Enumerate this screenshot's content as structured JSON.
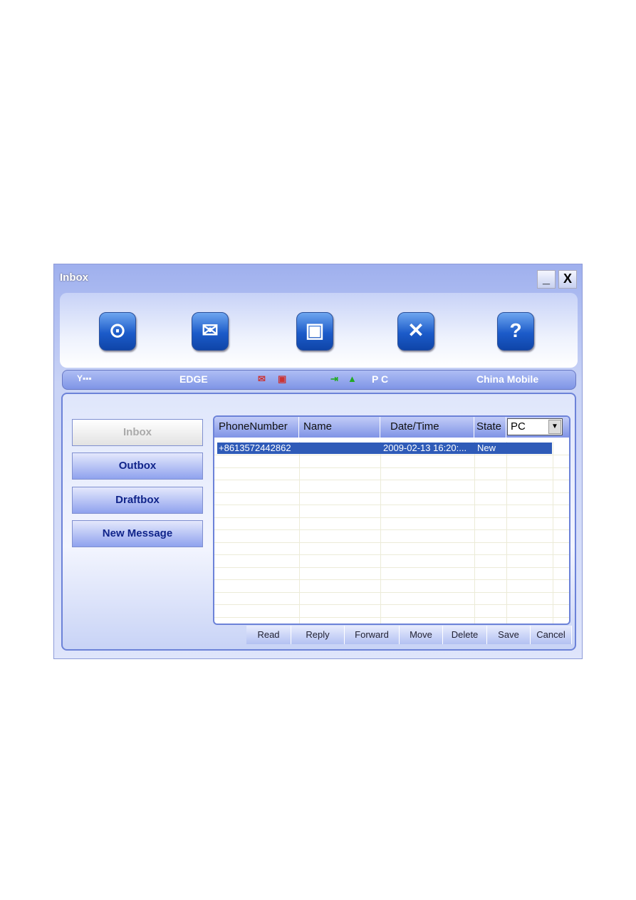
{
  "window": {
    "title": "Inbox",
    "minimize": "_",
    "close": "X"
  },
  "toolbar": {
    "items": [
      {
        "icon": "internet-globe-icon",
        "glyph": "⊙"
      },
      {
        "icon": "mail-envelope-icon",
        "glyph": "✉"
      },
      {
        "icon": "contacts-book-icon",
        "glyph": "▣"
      },
      {
        "icon": "tools-settings-icon",
        "glyph": "✕"
      },
      {
        "icon": "help-question-icon",
        "glyph": "?"
      }
    ]
  },
  "status": {
    "signal_icon": "Y▪▪▪",
    "network": "EDGE",
    "storage": "P C",
    "operator": "China Mobile"
  },
  "sidebar": {
    "items": [
      {
        "label": "Inbox"
      },
      {
        "label": "Outbox"
      },
      {
        "label": "Draftbox"
      },
      {
        "label": "New Message"
      }
    ]
  },
  "table": {
    "columns": [
      "PhoneNumber",
      "Name",
      "Date/Time",
      "State"
    ],
    "filter": "PC",
    "rows": [
      {
        "phone": "+8613572442862",
        "name": "",
        "datetime": "2009-02-13  16:20:...",
        "state": "New"
      }
    ]
  },
  "actions": [
    "Read",
    "Reply",
    "Forward",
    "Move",
    "Delete",
    "Save",
    "Cancel"
  ]
}
